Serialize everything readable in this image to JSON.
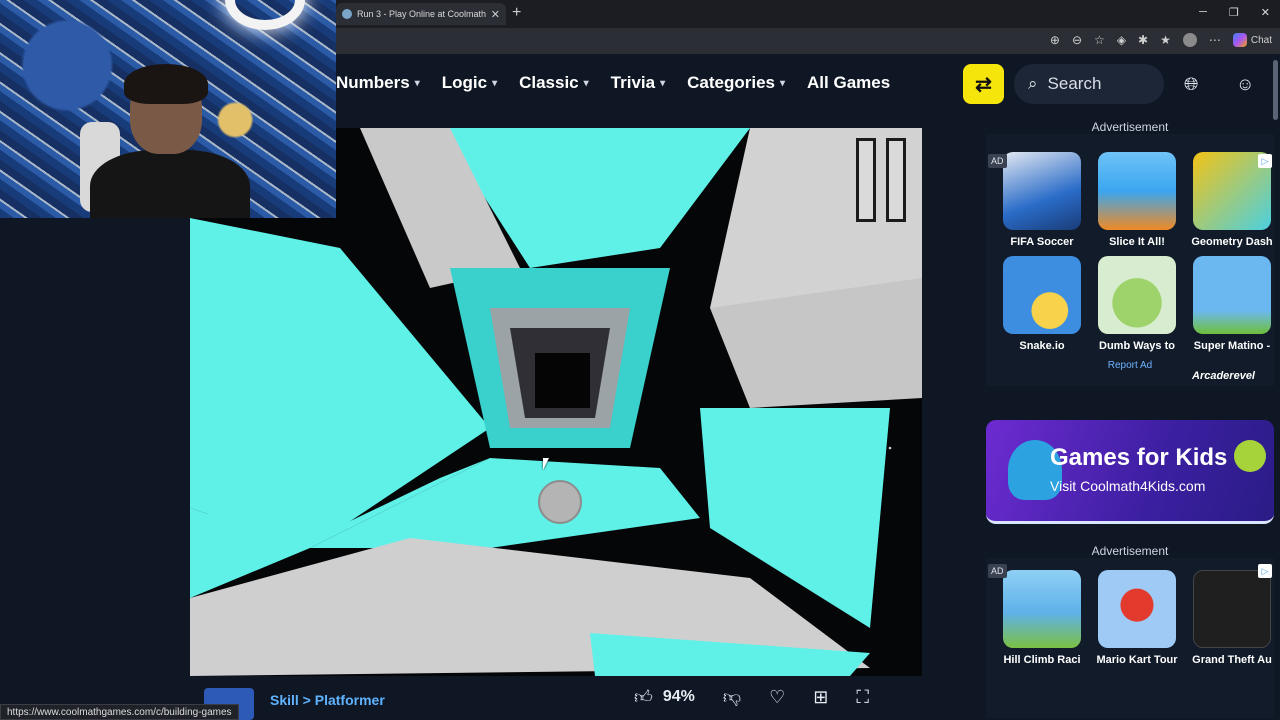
{
  "browser": {
    "tab_title": "Run 3 - Play Online at Coolmath Games",
    "new_tab_symbol": "+",
    "chat_label": "Chat",
    "status_url": "https://www.coolmathgames.com/c/building-games"
  },
  "nav": {
    "items": [
      {
        "label": "Numbers"
      },
      {
        "label": "Logic"
      },
      {
        "label": "Classic"
      },
      {
        "label": "Trivia"
      },
      {
        "label": "Categories"
      },
      {
        "label": "All Games"
      }
    ],
    "search_label": "Search"
  },
  "game": {
    "breadcrumb": "Skill > Platformer",
    "rating": "94%"
  },
  "ads": {
    "advertisement_label": "Advertisement",
    "ad_tag": "AD",
    "top_grid": [
      {
        "name": "FIFA Soccer",
        "color": "#2a6cc8"
      },
      {
        "name": "Slice It All!",
        "color": "#3aa6ef"
      },
      {
        "name": "Geometry Dash",
        "color": "#f3c316"
      },
      {
        "name": "Snake.io",
        "color": "#3d8de0"
      },
      {
        "name": "Dumb Ways to",
        "color": "#9ed36b"
      },
      {
        "name": "Super Matino -",
        "color": "#6bb8f0"
      }
    ],
    "report_label": "Report Ad",
    "kids_title": "Games for Kids",
    "kids_subtitle": "Visit Coolmath4Kids.com",
    "bottom_grid": [
      {
        "name": "Hill Climb Raci",
        "color": "#5fb1e8"
      },
      {
        "name": "Mario Kart Tour",
        "color": "#9fcaf5"
      },
      {
        "name": "Grand Theft Au",
        "color": "#1f1f1f"
      }
    ],
    "watermark": "Arcaderevel"
  }
}
